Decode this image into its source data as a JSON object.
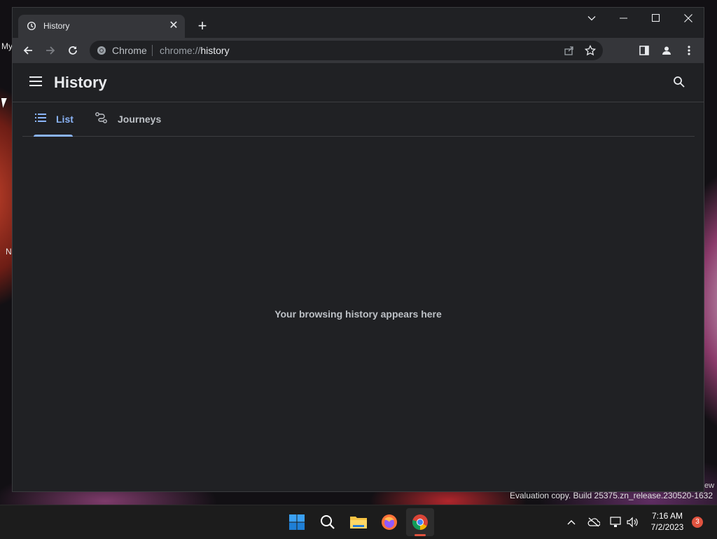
{
  "desktop": {
    "fragments": [
      "My",
      "N"
    ],
    "watermark": "Evaluation copy. Build 25375.zn_release.230520-1632",
    "watermark_fragment": "ew"
  },
  "browser": {
    "tab": {
      "title": "History",
      "icon": "history-icon",
      "close_icon": "close-icon"
    },
    "new_tab_icon": "plus-icon",
    "window_controls": [
      "chevron-down-icon",
      "minimize-icon",
      "maximize-icon",
      "close-icon"
    ],
    "omnibox": {
      "site_label": "Chrome",
      "url_scheme": "chrome://",
      "url_host": "history"
    },
    "toolbar_icons": [
      "back-icon",
      "forward-icon",
      "reload-icon",
      "share-icon",
      "bookmark-star-icon",
      "side-panel-icon",
      "profile-icon",
      "more-vert-icon"
    ]
  },
  "history_page": {
    "title": "History",
    "tabs": [
      {
        "label": "List",
        "icon": "list-icon",
        "selected": true
      },
      {
        "label": "Journeys",
        "icon": "journeys-icon",
        "selected": false
      }
    ],
    "empty_message": "Your browsing history appears here"
  },
  "taskbar": {
    "apps": [
      "start-icon",
      "search-icon",
      "file-explorer-icon",
      "firefox-icon",
      "chrome-icon"
    ],
    "active_app": "chrome-icon",
    "tray_icons": [
      "chevron-up-icon",
      "onedrive-offline-icon",
      "network-icon",
      "volume-icon"
    ],
    "time": "7:16 AM",
    "date": "7/2/2023",
    "notification_count": "3"
  },
  "colors": {
    "accent": "#8ab4f8",
    "window_bg": "#202124",
    "toolbar_bg": "#35363a",
    "taskbar_bg": "#1c1c1c",
    "notification_badge": "#e0533f"
  }
}
